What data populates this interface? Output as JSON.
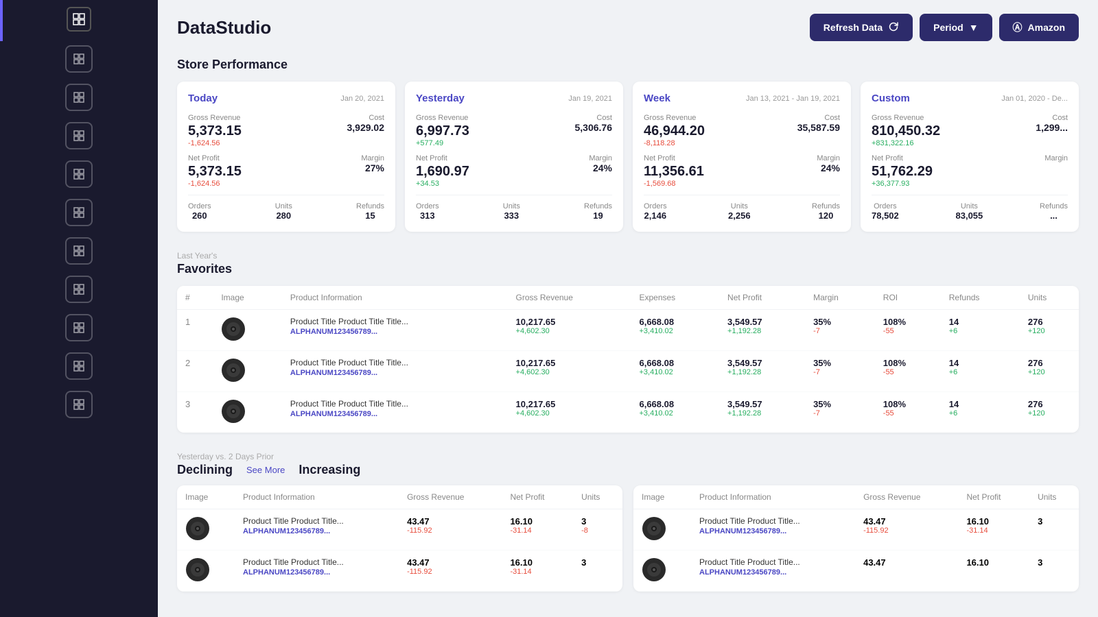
{
  "app": {
    "title": "DataStudio"
  },
  "header": {
    "refresh_label": "Refresh Data",
    "period_label": "Period",
    "amazon_label": "Amazon"
  },
  "store_performance": {
    "title": "Store Performance",
    "cards": [
      {
        "period": "Today",
        "date": "Jan 20, 2021",
        "gross_revenue_label": "Gross Revenue",
        "gross_revenue": "5,373.15",
        "gross_revenue_delta": "-1,624.56",
        "gross_revenue_delta_type": "negative",
        "cost_label": "Cost",
        "cost": "3,929.02",
        "net_profit_label": "Net Profit",
        "net_profit": "5,373.15",
        "net_profit_delta": "-1,624.56",
        "net_profit_delta_type": "negative",
        "margin_label": "Margin",
        "margin": "27%",
        "orders_label": "Orders",
        "orders": "260",
        "units_label": "Units",
        "units": "280",
        "refunds_label": "Refunds",
        "refunds": "15"
      },
      {
        "period": "Yesterday",
        "date": "Jan 19, 2021",
        "gross_revenue_label": "Gross Revenue",
        "gross_revenue": "6,997.73",
        "gross_revenue_delta": "+577.49",
        "gross_revenue_delta_type": "positive",
        "cost_label": "Cost",
        "cost": "5,306.76",
        "net_profit_label": "Net Profit",
        "net_profit": "1,690.97",
        "net_profit_delta": "+34.53",
        "net_profit_delta_type": "positive",
        "margin_label": "Margin",
        "margin": "24%",
        "orders_label": "Orders",
        "orders": "313",
        "units_label": "Units",
        "units": "333",
        "refunds_label": "Refunds",
        "refunds": "19"
      },
      {
        "period": "Week",
        "date": "Jan 13, 2021 - Jan 19, 2021",
        "gross_revenue_label": "Gross Revenue",
        "gross_revenue": "46,944.20",
        "gross_revenue_delta": "-8,118.28",
        "gross_revenue_delta_type": "negative",
        "cost_label": "Cost",
        "cost": "35,587.59",
        "net_profit_label": "Net Profit",
        "net_profit": "11,356.61",
        "net_profit_delta": "-1,569.68",
        "net_profit_delta_type": "negative",
        "margin_label": "Margin",
        "margin": "24%",
        "orders_label": "Orders",
        "orders": "2,146",
        "units_label": "Units",
        "units": "2,256",
        "refunds_label": "Refunds",
        "refunds": "120"
      },
      {
        "period": "Custom",
        "date": "Jan 01, 2020 - De...",
        "gross_revenue_label": "Gross Revenue",
        "gross_revenue": "810,450.32",
        "gross_revenue_delta": "+831,322.16",
        "gross_revenue_delta_type": "positive",
        "cost_label": "Cost",
        "cost": "1,299...",
        "net_profit_label": "Net Profit",
        "net_profit": "51,762.29",
        "net_profit_delta": "+36,377.93",
        "net_profit_delta_type": "positive",
        "margin_label": "Margin",
        "margin": "",
        "orders_label": "Orders",
        "orders": "78,502",
        "units_label": "Units",
        "units": "83,055",
        "refunds_label": "Refunds",
        "refunds": "..."
      }
    ]
  },
  "favorites": {
    "sub_label": "Last Year's",
    "title": "Favorites",
    "columns": {
      "num": "#",
      "image": "Image",
      "product_info": "Product Information",
      "gross_revenue": "Gross Revenue",
      "expenses": "Expenses",
      "net_profit": "Net Profit",
      "margin": "Margin",
      "roi": "ROI",
      "refunds": "Refunds",
      "units": "Units"
    },
    "rows": [
      {
        "num": "1",
        "product_title": "Product Title Product Title Title...",
        "product_asin": "ALPHANUM123456789...",
        "gross_revenue": "10,217.65",
        "gross_revenue_delta": "+4,602.30",
        "expenses": "6,668.08",
        "expenses_delta": "+3,410.02",
        "net_profit": "3,549.57",
        "net_profit_delta": "+1,192.28",
        "margin": "35%",
        "margin_delta": "-7",
        "roi": "108%",
        "roi_delta": "-55",
        "refunds": "14",
        "refunds_delta": "+6",
        "units": "276",
        "units_delta": "+120"
      },
      {
        "num": "2",
        "product_title": "Product Title Product Title Title...",
        "product_asin": "ALPHANUM123456789...",
        "gross_revenue": "10,217.65",
        "gross_revenue_delta": "+4,602.30",
        "expenses": "6,668.08",
        "expenses_delta": "+3,410.02",
        "net_profit": "3,549.57",
        "net_profit_delta": "+1,192.28",
        "margin": "35%",
        "margin_delta": "-7",
        "roi": "108%",
        "roi_delta": "-55",
        "refunds": "14",
        "refunds_delta": "+6",
        "units": "276",
        "units_delta": "+120"
      },
      {
        "num": "3",
        "product_title": "Product Title Product Title Title...",
        "product_asin": "ALPHANUM123456789...",
        "gross_revenue": "10,217.65",
        "gross_revenue_delta": "+4,602.30",
        "expenses": "6,668.08",
        "expenses_delta": "+3,410.02",
        "net_profit": "3,549.57",
        "net_profit_delta": "+1,192.28",
        "margin": "35%",
        "margin_delta": "-7",
        "roi": "108%",
        "roi_delta": "-55",
        "refunds": "14",
        "refunds_delta": "+6",
        "units": "276",
        "units_delta": "+120"
      }
    ]
  },
  "declining_increasing": {
    "sub_label": "Yesterday vs. 2 Days Prior",
    "declining_title": "Declining",
    "increasing_title": "Increasing",
    "see_more_label": "See More",
    "columns": {
      "image": "Image",
      "product_info": "Product Information",
      "gross_revenue": "Gross Revenue",
      "net_profit": "Net Profit",
      "units": "Units"
    },
    "declining_rows": [
      {
        "product_title": "Product Title Product Title...",
        "product_asin": "ALPHANUM123456789...",
        "gross_revenue": "43.47",
        "gross_revenue_delta": "-115.92",
        "net_profit": "16.10",
        "net_profit_delta": "-31.14",
        "units": "3",
        "units_delta": "-8"
      },
      {
        "product_title": "Product Title Product Title...",
        "product_asin": "ALPHANUM123456789...",
        "gross_revenue": "43.47",
        "gross_revenue_delta": "-115.92",
        "net_profit": "16.10",
        "net_profit_delta": "-31.14",
        "units": "3",
        "units_delta": ""
      }
    ],
    "increasing_rows": [
      {
        "product_title": "Product Title Product Title...",
        "product_asin": "ALPHANUM123456789...",
        "gross_revenue": "43.47",
        "gross_revenue_delta": "-115.92",
        "net_profit": "16.10",
        "net_profit_delta": "-31.14",
        "units": "3",
        "units_delta": ""
      },
      {
        "product_title": "Product Title Product Title...",
        "product_asin": "ALPHANUM123456789...",
        "gross_revenue": "43.47",
        "gross_revenue_delta": "",
        "net_profit": "16.10",
        "net_profit_delta": "",
        "units": "3",
        "units_delta": ""
      }
    ]
  },
  "sidebar": {
    "nav_items": [
      "nav-1",
      "nav-2",
      "nav-3",
      "nav-4",
      "nav-5",
      "nav-6",
      "nav-7",
      "nav-8",
      "nav-9",
      "nav-10"
    ]
  }
}
